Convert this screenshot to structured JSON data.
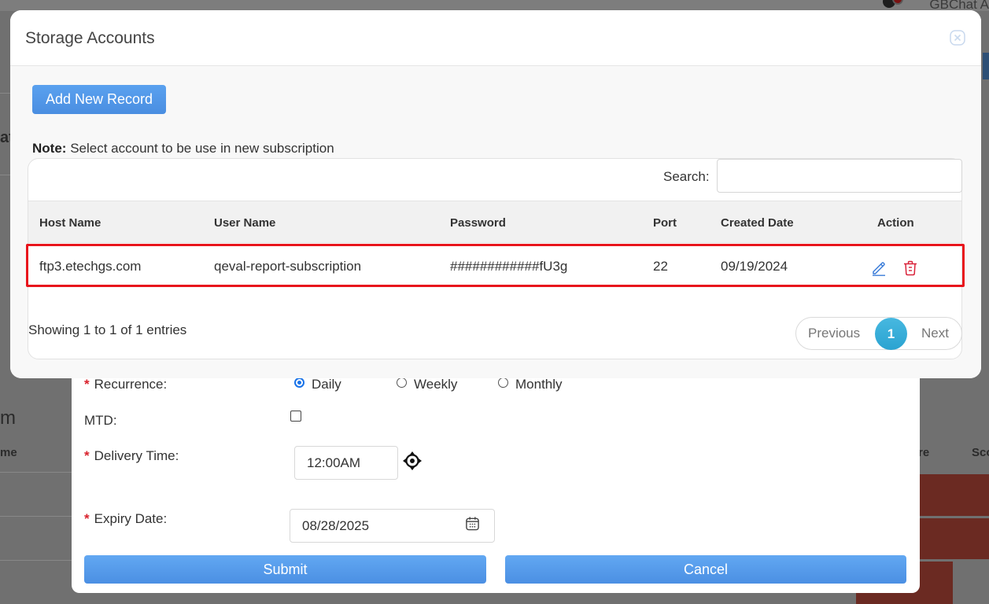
{
  "background": {
    "user_name": "GBChat A",
    "left_letters": [
      "at",
      "m",
      "me"
    ],
    "header_right": [
      "re",
      "Sco"
    ]
  },
  "modal": {
    "title": "Storage Accounts",
    "add_button": "Add New Record",
    "note_label": "Note:",
    "note_text": "Select account to be use in new subscription",
    "search_label": "Search:",
    "search_value": "",
    "columns": [
      "Host Name",
      "User Name",
      "Password",
      "Port",
      "Created Date",
      "Action"
    ],
    "rows": [
      {
        "host_name": "ftp3.etechgs.com",
        "user_name": "qeval-report-subscription",
        "password": "############fU3g",
        "port": "22",
        "created_date": "09/19/2024",
        "actions": [
          "edit-icon",
          "delete-icon"
        ]
      }
    ],
    "showing_text": "Showing 1 to 1 of 1 entries",
    "pagination": {
      "previous": "Previous",
      "current_page": "1",
      "next": "Next"
    }
  },
  "form": {
    "recurrence_label": "Recurrence:",
    "recurrence_options": [
      "Daily",
      "Weekly",
      "Monthly"
    ],
    "recurrence_selected": "Daily",
    "mtd_label": "MTD:",
    "mtd_checked": false,
    "delivery_time_label": "Delivery Time:",
    "delivery_time_value": "12:00AM",
    "expiry_date_label": "Expiry Date:",
    "expiry_date_value": "08/28/2025",
    "submit_label": "Submit",
    "cancel_label": "Cancel"
  },
  "colors": {
    "highlight": "#e8141c",
    "primary_button": "#4b8fe3",
    "page_active": "#2aa3d1",
    "required": "#d9232d"
  }
}
